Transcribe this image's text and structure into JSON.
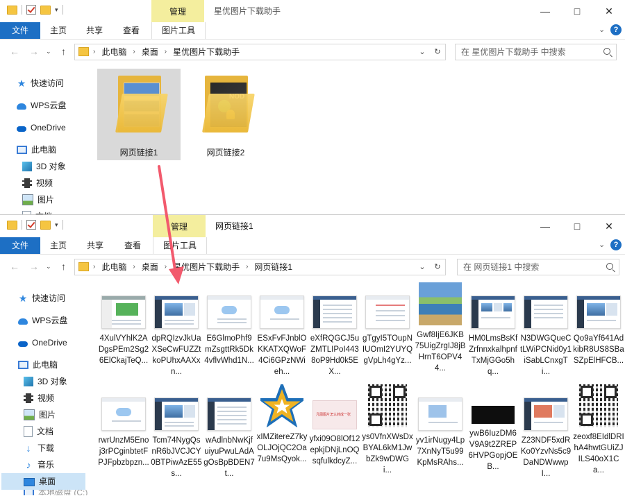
{
  "window1": {
    "manage_tab": "管理",
    "title": "星优图片下载助手",
    "ribbon": {
      "file": "文件",
      "home": "主页",
      "share": "共享",
      "view": "查看",
      "picture_tools": "图片工具"
    },
    "breadcrumbs": [
      "此电脑",
      "桌面",
      "星优图片下载助手"
    ],
    "search_placeholder": "在 星优图片下载助手 中搜索",
    "nav": [
      "快速访问",
      "WPS云盘",
      "OneDrive",
      "此电脑",
      "3D 对象",
      "视频",
      "图片",
      "文档"
    ],
    "folders": [
      "网页链接1",
      "网页链接2"
    ]
  },
  "window2": {
    "manage_tab": "管理",
    "title": "网页链接1",
    "ribbon": {
      "file": "文件",
      "home": "主页",
      "share": "共享",
      "view": "查看",
      "picture_tools": "图片工具"
    },
    "breadcrumbs": [
      "此电脑",
      "桌面",
      "星优图片下载助手",
      "网页链接1"
    ],
    "search_placeholder": "在 网页链接1 中搜索",
    "nav": [
      "快速访问",
      "WPS云盘",
      "OneDrive",
      "此电脑",
      "3D 对象",
      "视频",
      "图片",
      "文档",
      "下载",
      "音乐",
      "桌面",
      "本地磁盘 (C:)"
    ],
    "files_row1": [
      "4XulVYhlK2ADgsPEm2Sg26ElCkajTeQ...",
      "dpRQIzvJkUaXSeCwFUZZtkoPUhxAAXxn...",
      "E6GlmoPhf9mZsgttRk5Dk4vflvWhd1N...",
      "ESxFvFJnblOKKATXQWoF4Ci6GPzNWieh...",
      "eXfRQGCJ5uZMTLIPoI4438oP9Hd0k5EX...",
      "gTgyI5TOupNIUOmI2YUYQgVpLh4gYz...",
      "Gwf8IjE6JKB75UigZrgIJ8jBHrnT6OPV44...",
      "HM0LmsBsKfZrfnnxkalhpnfTxMjGGo5hq...",
      "N3DWGQueCtLWiPCNid0y1iSabLCnxgTi...",
      "Qo9aYf641AdkibR8US8SBaSZpElHFCB..."
    ],
    "files_row2": [
      "rwrUnzM5Enoj3rPCginbtetFPJFpbzbpzn...",
      "Tcm74NygQsnR6bJVCJCY0BTPiwAzE55s...",
      "wAdlnbNwKjfuiyuPwuLAdAgOsBpBDEN7t...",
      "xIMZitereZ7kyOLJOjQC2Oa7u9MsQyok...",
      "yfxi09O8lOf12epkjDNjLnOQsqfulkdcyZ...",
      "ys0VfnXWsDxBYAL6kM1JwbZk9wDWGi...",
      "yv1irNugy4Lp7XnNyT5u99KpMsRAhs...",
      "ywB6IuzDM6V9A9t2ZREP6HVPGopjOEB...",
      "Z23NDF5xdRKo0YzvNs5c9DaNDWwwpI...",
      "zeoxf8EIdlDRIhA4hwtGUiZJILS40oX1Ca..."
    ],
    "card_text": "凡图图片怎么转成一张"
  },
  "accent": "#1d6fc4",
  "arrow_color": "#f25a6d"
}
